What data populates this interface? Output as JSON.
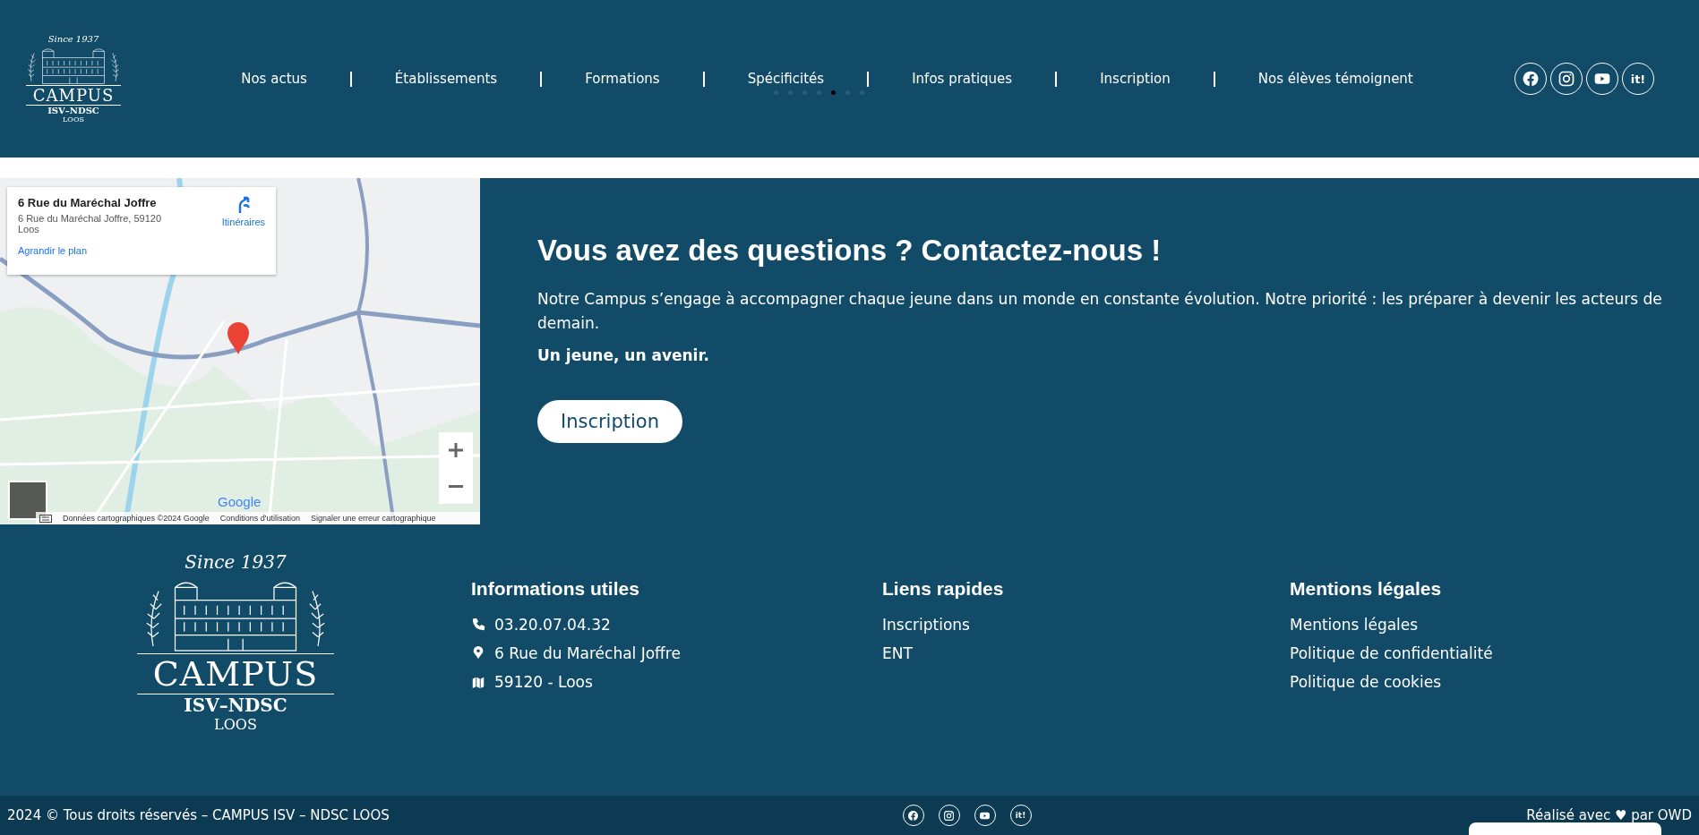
{
  "header": {
    "logo": {
      "since": "Since 1937",
      "name": "CAMPUS",
      "subtitle": "ISV–NDSC",
      "town": "LOOS"
    },
    "nav": [
      {
        "label": "Nos actus"
      },
      {
        "label": "Établissements"
      },
      {
        "label": "Formations"
      },
      {
        "label": "Spécificités"
      },
      {
        "label": "Infos pratiques"
      },
      {
        "label": "Inscription"
      },
      {
        "label": "Nos élèves témoignent"
      }
    ],
    "slider_dots": [
      {
        "selected": false
      },
      {
        "selected": false
      },
      {
        "selected": false
      },
      {
        "selected": false
      },
      {
        "selected": true
      },
      {
        "selected": false
      },
      {
        "selected": false
      }
    ],
    "social": [
      {
        "kind": "facebook"
      },
      {
        "kind": "instagram"
      },
      {
        "kind": "youtube"
      },
      {
        "kind": "itunes",
        "label": "it!"
      }
    ]
  },
  "map": {
    "card": {
      "title": "6 Rue du Maréchal Joffre",
      "address": "6 Rue du Maréchal Joffre, 59120 Loos",
      "directions": "Itinéraires",
      "enlarge": "Agrandir le plan"
    },
    "google": "Google",
    "attribution": [
      "Données cartographiques ©2024 Google",
      "Conditions d'utilisation",
      "Signaler une erreur cartographique"
    ]
  },
  "contact": {
    "title": "Vous avez des questions ? Contactez-nous !",
    "text": "Notre Campus s’engage à accompagner chaque jeune dans un monde en constante évolution. Notre priorité : les préparer à devenir les acteurs de demain.",
    "tagline": "Un jeune, un avenir.",
    "button": "Inscription"
  },
  "footer": {
    "logo": {
      "since": "Since 1937",
      "name": "CAMPUS",
      "subtitle": "ISV–NDSC",
      "town": "LOOS"
    },
    "columns": [
      {
        "title": "Informations utiles",
        "links": [
          {
            "kind": "phone",
            "text": "03.20.07.04.32"
          },
          {
            "kind": "pin",
            "text": "6 Rue du Maréchal Joffre"
          },
          {
            "kind": "map",
            "text": "59120 - Loos"
          }
        ]
      },
      {
        "title": "Liens rapides",
        "links": [
          {
            "text": "Inscriptions"
          },
          {
            "text": "ENT"
          }
        ]
      },
      {
        "title": "Mentions légales",
        "links": [
          {
            "text": "Mentions légales"
          },
          {
            "text": "Politique de confidentialité"
          },
          {
            "text": "Politique de cookies"
          }
        ]
      }
    ]
  },
  "bottom": {
    "copyright": "2024 © Tous droits réservés – CAMPUS ISV – NDSC LOOS",
    "social": [
      {
        "kind": "facebook"
      },
      {
        "kind": "instagram"
      },
      {
        "kind": "youtube"
      },
      {
        "kind": "itunes",
        "label": "it!"
      }
    ],
    "credit": "Réalisé avec ♥ par OWD"
  }
}
